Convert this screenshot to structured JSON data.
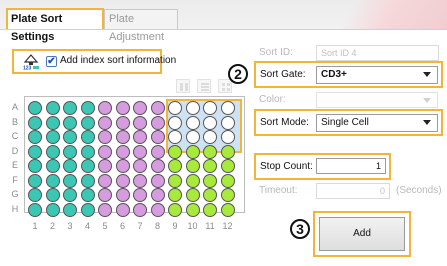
{
  "tabs": [
    {
      "label": "Plate Sort Settings",
      "active": true
    },
    {
      "label": "Plate Adjustment",
      "active": false
    }
  ],
  "index_sort": {
    "label": "Add index sort information",
    "checked": true,
    "icon": "index-sort-icon",
    "checkmark": "✔"
  },
  "plate": {
    "rows": [
      "A",
      "B",
      "C",
      "D",
      "E",
      "F",
      "G",
      "H"
    ],
    "columns": [
      "1",
      "2",
      "3",
      "4",
      "5",
      "6",
      "7",
      "8",
      "9",
      "10",
      "11",
      "12"
    ],
    "colors": {
      "teal": "#3cc7b4",
      "purple": "#d79be0",
      "green": "#a8ea3c",
      "white": "#ffffff",
      "selection": "#cfe2f4",
      "accent": "#f3b43a"
    }
  },
  "fields": {
    "sort_id": {
      "label": "Sort ID:",
      "placeholder": "Sort ID 4"
    },
    "sort_gate": {
      "label": "Sort Gate:",
      "value": "CD3+"
    },
    "color": {
      "label": "Color:"
    },
    "sort_mode": {
      "label": "Sort Mode:",
      "value": "Single Cell"
    },
    "stop_count": {
      "label": "Stop Count:",
      "value": "1"
    },
    "timeout": {
      "label": "Timeout:",
      "value": "0",
      "unit": "(Seconds)"
    }
  },
  "badges": [
    "2",
    "3"
  ],
  "add_button": {
    "label": "Add"
  }
}
